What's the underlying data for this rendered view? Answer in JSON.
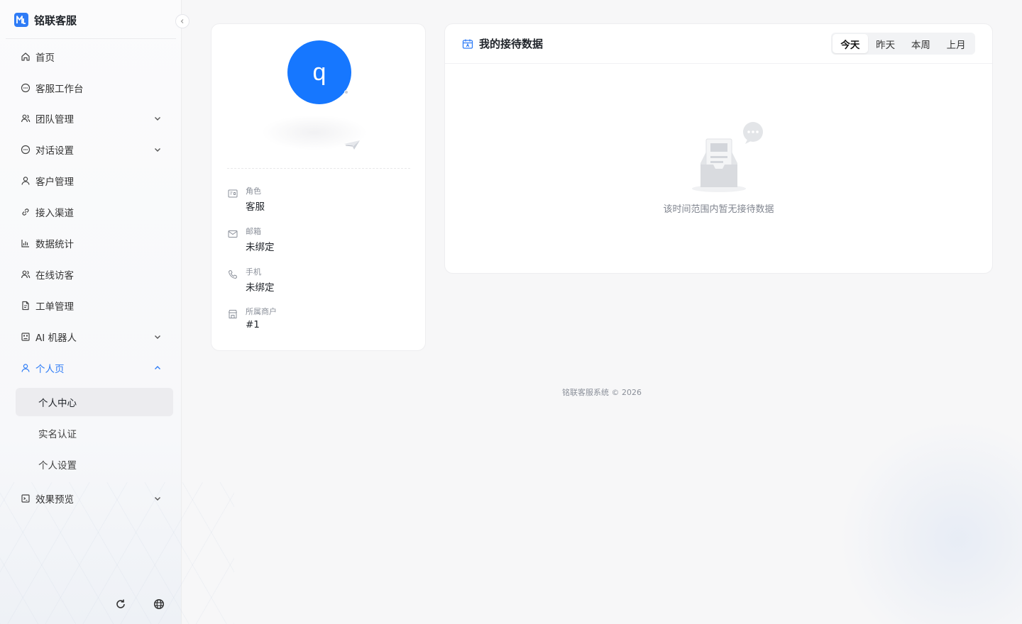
{
  "brand": {
    "name": "铭联客服"
  },
  "sidebar": {
    "items": [
      {
        "label": "首页",
        "icon": "home-icon"
      },
      {
        "label": "客服工作台",
        "icon": "chat-icon"
      },
      {
        "label": "团队管理",
        "icon": "team-icon",
        "expandable": true
      },
      {
        "label": "对话设置",
        "icon": "chat-settings-icon",
        "expandable": true
      },
      {
        "label": "客户管理",
        "icon": "user-icon"
      },
      {
        "label": "接入渠道",
        "icon": "link-icon"
      },
      {
        "label": "数据统计",
        "icon": "bar-chart-icon"
      },
      {
        "label": "在线访客",
        "icon": "visitors-icon"
      },
      {
        "label": "工单管理",
        "icon": "ticket-icon"
      },
      {
        "label": "AI 机器人",
        "icon": "robot-icon",
        "expandable": true
      },
      {
        "label": "个人页",
        "icon": "user-icon",
        "expandable": true,
        "expanded": true,
        "active": true
      },
      {
        "label": "效果预览",
        "icon": "preview-icon",
        "expandable": true
      }
    ],
    "sub_items": [
      {
        "label": "个人中心",
        "selected": true
      },
      {
        "label": "实名认证"
      },
      {
        "label": "个人设置"
      }
    ]
  },
  "profile": {
    "avatar_letter": "q",
    "fields": [
      {
        "label": "角色",
        "value": "客服",
        "icon": "role-card-icon"
      },
      {
        "label": "邮箱",
        "value": "未绑定",
        "icon": "mail-icon"
      },
      {
        "label": "手机",
        "value": "未绑定",
        "icon": "phone-icon"
      },
      {
        "label": "所属商户",
        "value": "#1",
        "icon": "store-icon"
      }
    ]
  },
  "reception": {
    "title": "我的接待数据",
    "periods": [
      "今天",
      "昨天",
      "本周",
      "上月"
    ],
    "selected_period": "今天",
    "empty_text": "该时间范围内暂无接待数据"
  },
  "footer": {
    "text": "铭联客服系统 © 2026"
  },
  "colors": {
    "accent": "#2f7cf6",
    "avatar": "#1677ff"
  }
}
